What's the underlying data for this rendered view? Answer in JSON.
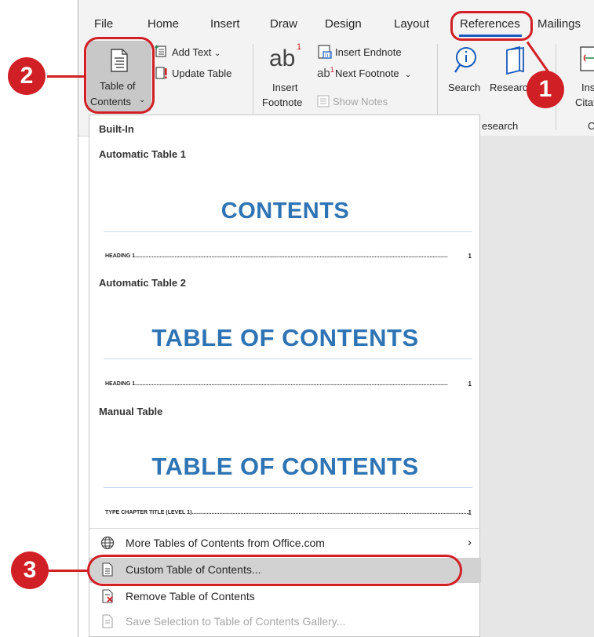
{
  "tabs": [
    "File",
    "Home",
    "Insert",
    "Draw",
    "Design",
    "Layout",
    "References",
    "Mailings"
  ],
  "ribbon": {
    "toc_button": [
      "Table of",
      "Contents"
    ],
    "add_text": "Add Text",
    "update_table": "Update Table",
    "insert_footnote": [
      "Insert",
      "Footnote"
    ],
    "insert_endnote": "Insert Endnote",
    "next_footnote": "Next Footnote",
    "show_notes": "Show Notes",
    "search": "Search",
    "researcher": "Research",
    "research_group": "esearch",
    "insert_citation": [
      "Ins",
      "Citati"
    ],
    "group_c": "C"
  },
  "dropdown": {
    "builtin_label": "Built-In",
    "auto1_label": "Automatic Table 1",
    "auto1_heading": "CONTENTS",
    "auto1_entry": "HEADING 1",
    "auto1_page": "1",
    "auto2_label": "Automatic Table 2",
    "auto2_heading": "TABLE OF CONTENTS",
    "auto2_entry": "HEADING 1",
    "auto2_page": "1",
    "manual_label": "Manual Table",
    "manual_heading": "TABLE OF CONTENTS",
    "manual_entry": "TYPE CHAPTER TITLE (LEVEL 1)",
    "manual_page": "1",
    "menu": {
      "more": "More Tables of Contents from Office.com",
      "custom": "Custom Table of Contents...",
      "remove": "Remove Table of Contents",
      "save": "Save Selection to Table of Contents Gallery..."
    }
  },
  "annotations": [
    "1",
    "2",
    "3"
  ],
  "colors": {
    "accent": "#185abd",
    "annotation": "#d01f25",
    "heading": "#2e74b5"
  }
}
